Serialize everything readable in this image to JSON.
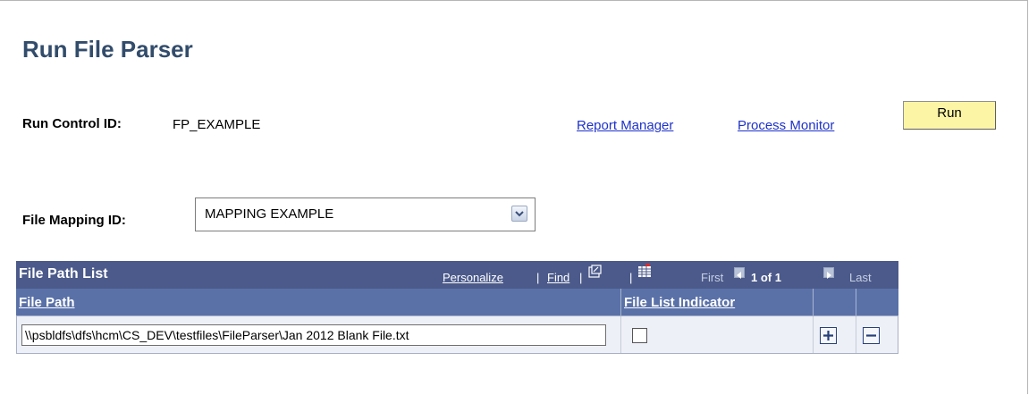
{
  "page": {
    "title": "Run File Parser"
  },
  "run_control": {
    "label": "Run Control ID:",
    "value": "FP_EXAMPLE"
  },
  "links": {
    "report_manager": "Report Manager",
    "process_monitor": "Process Monitor"
  },
  "run_button": {
    "label": "Run"
  },
  "file_mapping": {
    "label": "File Mapping ID:",
    "selected": "MAPPING EXAMPLE"
  },
  "grid": {
    "title": "File Path List",
    "personalize": "Personalize",
    "find": "Find",
    "sep": "|",
    "first": "First",
    "page_indicator": "1 of 1",
    "last": "Last",
    "columns": [
      "File Path",
      "File List Indicator"
    ],
    "rows": [
      {
        "file_path": "\\\\psbldfs\\dfs\\hcm\\CS_DEV\\testfiles\\FileParser\\Jan 2012 Blank File.txt",
        "file_list_indicator": false
      }
    ]
  },
  "icons": {
    "view_all": "view-all-icon",
    "download": "download-to-spreadsheet-icon",
    "first": "first-arrow-icon",
    "last": "last-arrow-icon",
    "add_row": "plus-icon",
    "delete_row": "minus-icon",
    "dropdown": "chevron-down-icon"
  },
  "colors": {
    "title": "#324c6b",
    "link": "#1e32c8",
    "grid_header": "#4b5a8a",
    "run_button": "#fcf5a6"
  }
}
